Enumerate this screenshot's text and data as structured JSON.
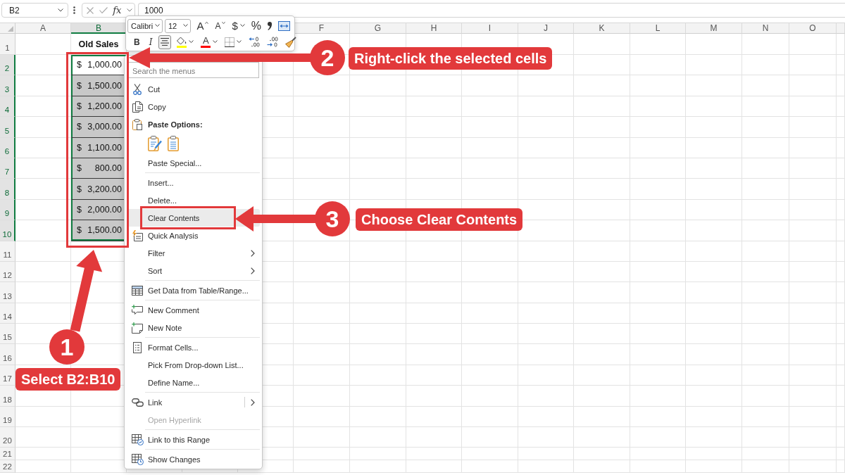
{
  "formula_bar": {
    "name_box": "B2",
    "function_label": "fx",
    "formula": "1000"
  },
  "sheet": {
    "columns": [
      {
        "label": "A",
        "selected": false
      },
      {
        "label": "B",
        "selected": true
      },
      {
        "label": "F",
        "selected": false
      },
      {
        "label": "G",
        "selected": false
      },
      {
        "label": "H",
        "selected": false
      },
      {
        "label": "I",
        "selected": false
      },
      {
        "label": "J",
        "selected": false
      },
      {
        "label": "K",
        "selected": false
      },
      {
        "label": "L",
        "selected": false
      },
      {
        "label": "M",
        "selected": false
      },
      {
        "label": "N",
        "selected": false
      },
      {
        "label": "O",
        "selected": false
      }
    ],
    "rows": [
      {
        "label": "1",
        "selected": false,
        "cell_b": {
          "kind": "header",
          "text": "Old Sales"
        }
      },
      {
        "label": "2",
        "selected": true,
        "cell_b": {
          "kind": "currency",
          "symbol": "$",
          "amount": "1,000.00",
          "active": true
        }
      },
      {
        "label": "3",
        "selected": true,
        "cell_b": {
          "kind": "currency",
          "symbol": "$",
          "amount": "1,500.00",
          "active": false
        }
      },
      {
        "label": "4",
        "selected": true,
        "cell_b": {
          "kind": "currency",
          "symbol": "$",
          "amount": "1,200.00",
          "active": false
        }
      },
      {
        "label": "5",
        "selected": true,
        "cell_b": {
          "kind": "currency",
          "symbol": "$",
          "amount": "3,000.00",
          "active": false
        }
      },
      {
        "label": "6",
        "selected": true,
        "cell_b": {
          "kind": "currency",
          "symbol": "$",
          "amount": "1,100.00",
          "active": false
        }
      },
      {
        "label": "7",
        "selected": true,
        "cell_b": {
          "kind": "currency",
          "symbol": "$",
          "amount": "800.00",
          "active": false
        }
      },
      {
        "label": "8",
        "selected": true,
        "cell_b": {
          "kind": "currency",
          "symbol": "$",
          "amount": "3,200.00",
          "active": false
        }
      },
      {
        "label": "9",
        "selected": true,
        "cell_b": {
          "kind": "currency",
          "symbol": "$",
          "amount": "2,000.00",
          "active": false
        }
      },
      {
        "label": "10",
        "selected": true,
        "cell_b": {
          "kind": "currency",
          "symbol": "$",
          "amount": "1,500.00",
          "active": false
        }
      },
      {
        "label": "11",
        "selected": false
      },
      {
        "label": "12",
        "selected": false
      },
      {
        "label": "13",
        "selected": false
      },
      {
        "label": "14",
        "selected": false
      },
      {
        "label": "15",
        "selected": false
      },
      {
        "label": "16",
        "selected": false
      },
      {
        "label": "17",
        "selected": false
      },
      {
        "label": "18",
        "selected": false
      },
      {
        "label": "19",
        "selected": false
      },
      {
        "label": "20",
        "selected": false
      },
      {
        "label": "21",
        "selected": false
      },
      {
        "label": "22",
        "selected": false
      }
    ]
  },
  "mini_toolbar": {
    "font": "Calibri",
    "font_size": "12",
    "row_1": [
      {
        "kind": "grow_font",
        "label": "A",
        "dropdown": false,
        "selected": false
      },
      {
        "kind": "shrink_font",
        "label": "A",
        "dropdown": false,
        "selected": false
      },
      {
        "kind": "currency",
        "label": "$",
        "dropdown": true,
        "selected": false
      },
      {
        "kind": "percent",
        "label": "%",
        "dropdown": false,
        "selected": false
      },
      {
        "kind": "comma",
        "dropdown": false,
        "selected": false
      },
      {
        "kind": "merge_center",
        "dropdown": false,
        "selected": false
      }
    ],
    "row_2": [
      {
        "kind": "bold",
        "label": "B",
        "dropdown": false,
        "selected": false
      },
      {
        "kind": "italic",
        "label": "I",
        "dropdown": false,
        "selected": false
      },
      {
        "kind": "align_center",
        "dropdown": false,
        "selected": true
      },
      {
        "kind": "fill_color",
        "color": "#ffff00",
        "dropdown": true,
        "selected": false
      },
      {
        "kind": "font_color",
        "label": "A",
        "color": "#ff0000",
        "dropdown": true,
        "selected": false
      },
      {
        "kind": "borders",
        "dropdown": true,
        "selected": false
      },
      {
        "kind": "increase_decimal",
        "dropdown": false,
        "selected": false
      },
      {
        "kind": "decrease_decimal",
        "dropdown": false,
        "selected": false
      },
      {
        "kind": "format_painter",
        "dropdown": false,
        "selected": false
      }
    ]
  },
  "context_menu": {
    "search_placeholder": "Search the menus",
    "groups": [
      {
        "items": [
          {
            "kind": "command",
            "label": "Cut",
            "selected": false,
            "disabled": false
          },
          {
            "kind": "command",
            "label": "Copy",
            "selected": false,
            "disabled": false
          },
          {
            "kind": "heading",
            "label": "Paste Options:"
          },
          {
            "kind": "paste_icons"
          },
          {
            "kind": "command",
            "label": "Paste Special...",
            "selected": false,
            "disabled": false
          }
        ]
      },
      {
        "items": [
          {
            "kind": "command",
            "label": "Insert...",
            "selected": false,
            "disabled": false
          },
          {
            "kind": "command",
            "label": "Delete...",
            "selected": false,
            "disabled": false
          },
          {
            "kind": "command",
            "label": "Clear Contents",
            "selected": true,
            "disabled": false
          },
          {
            "kind": "command",
            "label": "Quick Analysis",
            "selected": false,
            "disabled": false
          },
          {
            "kind": "submenu",
            "label": "Filter",
            "selected": false,
            "disabled": false
          },
          {
            "kind": "submenu",
            "label": "Sort",
            "selected": false,
            "disabled": false
          }
        ]
      },
      {
        "items": [
          {
            "kind": "command",
            "label": "Get Data from Table/Range...",
            "selected": false,
            "disabled": false
          }
        ]
      },
      {
        "items": [
          {
            "kind": "command",
            "label": "New Comment",
            "selected": false,
            "disabled": false
          },
          {
            "kind": "command",
            "label": "New Note",
            "selected": false,
            "disabled": false
          }
        ]
      },
      {
        "items": [
          {
            "kind": "command",
            "label": "Format Cells...",
            "selected": false,
            "disabled": false
          },
          {
            "kind": "command",
            "label": "Pick From Drop-down List...",
            "selected": false,
            "disabled": false
          },
          {
            "kind": "command",
            "label": "Define Name...",
            "selected": false,
            "disabled": false
          }
        ]
      },
      {
        "items": [
          {
            "kind": "split_submenu",
            "label": "Link",
            "selected": false,
            "disabled": false
          },
          {
            "kind": "command",
            "label": "Open Hyperlink",
            "selected": false,
            "disabled": true
          }
        ]
      },
      {
        "items": [
          {
            "kind": "command",
            "label": "Link to this Range",
            "selected": false,
            "disabled": false
          }
        ]
      },
      {
        "items": [
          {
            "kind": "command",
            "label": "Show Changes",
            "selected": false,
            "disabled": false
          }
        ]
      }
    ]
  },
  "callouts": [
    {
      "number": "1",
      "text": "Select B2:B10"
    },
    {
      "number": "2",
      "text": "Right-click the selected cells"
    },
    {
      "number": "3",
      "text": "Choose Clear Contents"
    }
  ]
}
